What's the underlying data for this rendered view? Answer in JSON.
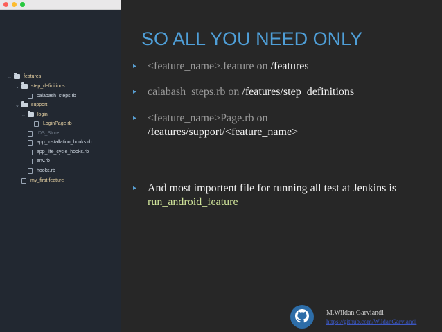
{
  "window": {
    "traffic_lights": [
      "close",
      "minimize",
      "zoom"
    ]
  },
  "file_tree": [
    {
      "name": "features",
      "kind": "folder",
      "expanded": true
    },
    {
      "name": "step_definitions",
      "kind": "folder",
      "expanded": true
    },
    {
      "name": "calabash_steps.rb",
      "kind": "file"
    },
    {
      "name": "support",
      "kind": "folder",
      "expanded": true
    },
    {
      "name": "login",
      "kind": "folder",
      "expanded": true
    },
    {
      "name": "LoginPage.rb",
      "kind": "file"
    },
    {
      "name": ".DS_Store",
      "kind": "file"
    },
    {
      "name": "app_installation_hooks.rb",
      "kind": "file"
    },
    {
      "name": "app_life_cycle_hooks.rb",
      "kind": "file"
    },
    {
      "name": "env.rb",
      "kind": "file"
    },
    {
      "name": "hooks.rb",
      "kind": "file"
    },
    {
      "name": "my_first.feature",
      "kind": "file"
    }
  ],
  "slide": {
    "title": "SO ALL YOU NEED ONLY",
    "bullets": [
      {
        "a": "<feature_name>.feature on ",
        "b": "/features"
      },
      {
        "a": "calabash_steps.rb on ",
        "b": "/features/step_definitions"
      },
      {
        "a": "<feature_name>Page.rb on",
        "b": "/features/support/<feature_name>"
      },
      {
        "a": "And most importent file for running all test at Jenkins is",
        "b": "run_android_feature"
      }
    ]
  },
  "footer": {
    "author": "M.Wildan Garviandi",
    "link": "https://github.com/WildanGarviandi",
    "icon": "github-icon"
  },
  "colors": {
    "title": "#4f9fd8",
    "bullet_mark": "#5aa2d6",
    "highlight": "#cfe39a",
    "sidebar_bg": "#222831",
    "slide_bg": "#272727"
  }
}
